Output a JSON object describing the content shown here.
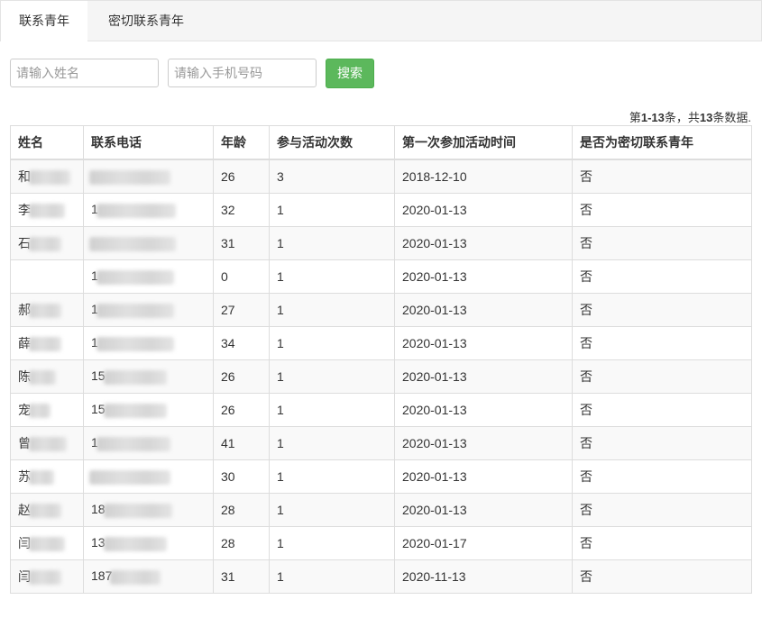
{
  "tabs": [
    {
      "label": "联系青年",
      "active": true
    },
    {
      "label": "密切联系青年",
      "active": false
    }
  ],
  "search": {
    "name_placeholder": "请输入姓名",
    "phone_placeholder": "请输入手机号码",
    "button_label": "搜索"
  },
  "summary": {
    "prefix": "第",
    "range": "1-13",
    "middle": "条，共",
    "total": "13",
    "suffix": "条数据."
  },
  "table": {
    "headers": [
      "姓名",
      "联系电话",
      "年龄",
      "参与活动次数",
      "第一次参加活动时间",
      "是否为密切联系青年"
    ],
    "rows": [
      {
        "name": "和",
        "phone": "",
        "age": "26",
        "count": "3",
        "date": "2018-12-10",
        "close": "否"
      },
      {
        "name": "李",
        "phone": "1",
        "age": "32",
        "count": "1",
        "date": "2020-01-13",
        "close": "否"
      },
      {
        "name": "石",
        "phone": "",
        "age": "31",
        "count": "1",
        "date": "2020-01-13",
        "close": "否"
      },
      {
        "name": "",
        "phone": "1",
        "age": "0",
        "count": "1",
        "date": "2020-01-13",
        "close": "否"
      },
      {
        "name": "郝",
        "phone": "1",
        "age": "27",
        "count": "1",
        "date": "2020-01-13",
        "close": "否"
      },
      {
        "name": "薛",
        "phone": "1",
        "age": "34",
        "count": "1",
        "date": "2020-01-13",
        "close": "否"
      },
      {
        "name": "陈",
        "phone": "15",
        "age": "26",
        "count": "1",
        "date": "2020-01-13",
        "close": "否"
      },
      {
        "name": "宠",
        "phone": "15",
        "age": "26",
        "count": "1",
        "date": "2020-01-13",
        "close": "否"
      },
      {
        "name": "曾",
        "phone": "1",
        "age": "41",
        "count": "1",
        "date": "2020-01-13",
        "close": "否"
      },
      {
        "name": "苏",
        "phone": "",
        "age": "30",
        "count": "1",
        "date": "2020-01-13",
        "close": "否"
      },
      {
        "name": "赵",
        "phone": "18",
        "age": "28",
        "count": "1",
        "date": "2020-01-13",
        "close": "否"
      },
      {
        "name": "闫",
        "phone": "13",
        "age": "28",
        "count": "1",
        "date": "2020-01-17",
        "close": "否"
      },
      {
        "name": "闫",
        "phone": "187",
        "age": "31",
        "count": "1",
        "date": "2020-11-13",
        "close": "否"
      }
    ]
  },
  "colors": {
    "accent_green": "#5cb85c",
    "tabbar_bg": "#f5f5f5",
    "stripe": "#f9f9f9",
    "border": "#dddddd"
  }
}
